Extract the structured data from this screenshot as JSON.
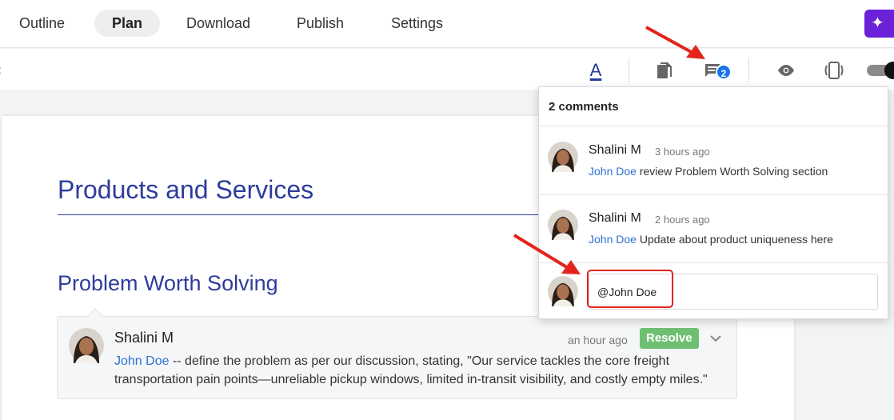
{
  "nav": {
    "tabs": [
      {
        "label": "Outline"
      },
      {
        "label": "Plan",
        "active": true
      },
      {
        "label": "Download"
      },
      {
        "label": "Publish"
      },
      {
        "label": "Settings"
      }
    ],
    "magic_icon": "sparkles-icon"
  },
  "toolbar": {
    "text_format_label": "A",
    "comment_count": "2",
    "icons": [
      "text-color-icon",
      "document-icon",
      "comment-icon",
      "eye-icon",
      "device-preview-icon",
      "toggle-switch"
    ]
  },
  "document": {
    "heading": "Products and Services",
    "subheading": "Problem Worth Solving",
    "inline_comment": {
      "author": "Shalini M",
      "time": "an hour ago",
      "resolve_label": "Resolve",
      "mention": "John Doe",
      "text": " -- define the problem as per our discussion, stating, \"Our service tackles the core freight transportation pain points—unreliable pickup windows, limited in-transit visibility, and costly empty miles.\""
    }
  },
  "comments_panel": {
    "title": "2 comments",
    "comments": [
      {
        "author": "Shalini M",
        "time": "3 hours ago",
        "mention": "John Doe",
        "text": " review Problem Worth Solving section"
      },
      {
        "author": "Shalini M",
        "time": "2 hours ago",
        "mention": "John Doe",
        "text": " Update about product uniqueness here"
      }
    ],
    "reply_value": "@John Doe"
  },
  "colors": {
    "accent": "#2d3c9c",
    "mention": "#2f6fd6",
    "badge": "#1a73e8",
    "resolve": "#6fbf73",
    "annotation": "#e3241b",
    "magic": "#6b21d8"
  }
}
